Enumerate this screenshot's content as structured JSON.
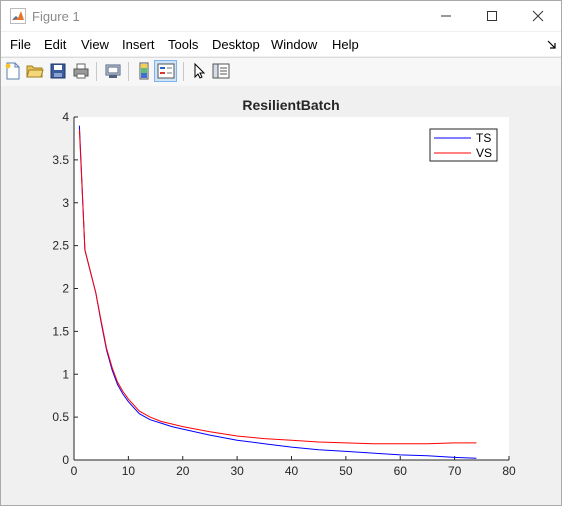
{
  "window": {
    "title": "Figure 1",
    "controls": {
      "minimize": "minimize",
      "maximize": "maximize",
      "close": "close"
    }
  },
  "menubar": {
    "items": [
      "File",
      "Edit",
      "View",
      "Insert",
      "Tools",
      "Desktop",
      "Window",
      "Help"
    ],
    "dock_arrow": "dock-arrow-icon"
  },
  "toolbar": {
    "buttons": [
      "new-figure-icon",
      "open-file-icon",
      "save-icon",
      "print-icon",
      "print-preview-icon",
      "colorbar-icon",
      "legend-icon",
      "edit-plot-arrow-icon",
      "property-inspector-icon"
    ],
    "active": [
      "legend-icon"
    ]
  },
  "colors": {
    "ts": "#0000ff",
    "vs": "#ff0000",
    "axes_bg": "#ffffff",
    "figure_bg": "#f0f0f0"
  },
  "chart_data": {
    "type": "line",
    "title": "ResilientBatch",
    "xlabel": "",
    "ylabel": "",
    "xlim": [
      0,
      80
    ],
    "ylim": [
      0,
      4
    ],
    "xticks": [
      0,
      10,
      20,
      30,
      40,
      50,
      60,
      70,
      80
    ],
    "yticks": [
      0,
      0.5,
      1,
      1.5,
      2,
      2.5,
      3,
      3.5,
      4
    ],
    "grid": false,
    "legend_position": "top-right",
    "series": [
      {
        "name": "TS",
        "color": "#0000ff",
        "x": [
          1,
          2,
          3,
          4,
          5,
          6,
          7,
          8,
          9,
          10,
          12,
          14,
          16,
          18,
          20,
          25,
          30,
          35,
          40,
          45,
          50,
          55,
          60,
          65,
          70,
          74
        ],
        "y": [
          3.9,
          2.45,
          2.2,
          1.95,
          1.6,
          1.28,
          1.05,
          0.88,
          0.77,
          0.68,
          0.54,
          0.47,
          0.43,
          0.39,
          0.36,
          0.29,
          0.23,
          0.19,
          0.15,
          0.12,
          0.1,
          0.08,
          0.06,
          0.05,
          0.03,
          0.02
        ]
      },
      {
        "name": "VS",
        "color": "#ff0000",
        "x": [
          1,
          2,
          3,
          4,
          5,
          6,
          7,
          8,
          9,
          10,
          12,
          14,
          16,
          18,
          20,
          25,
          30,
          35,
          40,
          45,
          50,
          55,
          60,
          65,
          70,
          74
        ],
        "y": [
          3.85,
          2.45,
          2.2,
          1.95,
          1.62,
          1.3,
          1.08,
          0.91,
          0.8,
          0.71,
          0.57,
          0.5,
          0.45,
          0.42,
          0.39,
          0.33,
          0.28,
          0.25,
          0.23,
          0.21,
          0.2,
          0.19,
          0.19,
          0.19,
          0.2,
          0.2
        ]
      }
    ]
  }
}
